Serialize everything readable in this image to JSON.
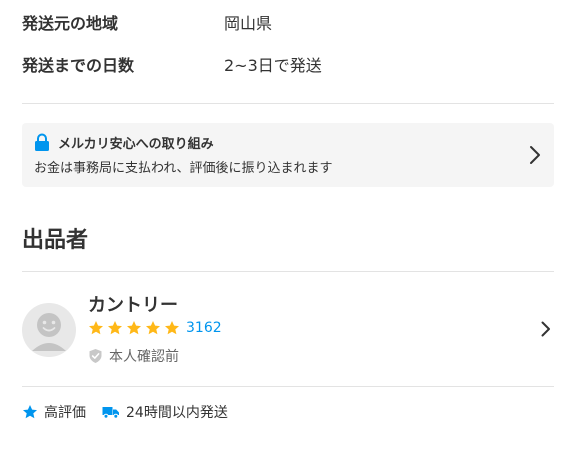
{
  "shipping": {
    "region_label": "発送元の地域",
    "region_value": "岡山県",
    "days_label": "発送までの日数",
    "days_value": "2~3日で発送"
  },
  "safety": {
    "title": "メルカリ安心への取り組み",
    "description": "お金は事務局に支払われ、評価後に振り込まれます",
    "icon": "lock-icon",
    "accent": "#0095ee"
  },
  "seller_section": {
    "title": "出品者"
  },
  "seller": {
    "name": "カントリー",
    "rating": 5,
    "rating_max": 5,
    "review_count": "3162",
    "verified_label": "本人確認前",
    "star_color": "#ffb818"
  },
  "badges": [
    {
      "icon": "star-icon",
      "label": "高評価"
    },
    {
      "icon": "truck-icon",
      "label": "24時間以内発送"
    }
  ]
}
